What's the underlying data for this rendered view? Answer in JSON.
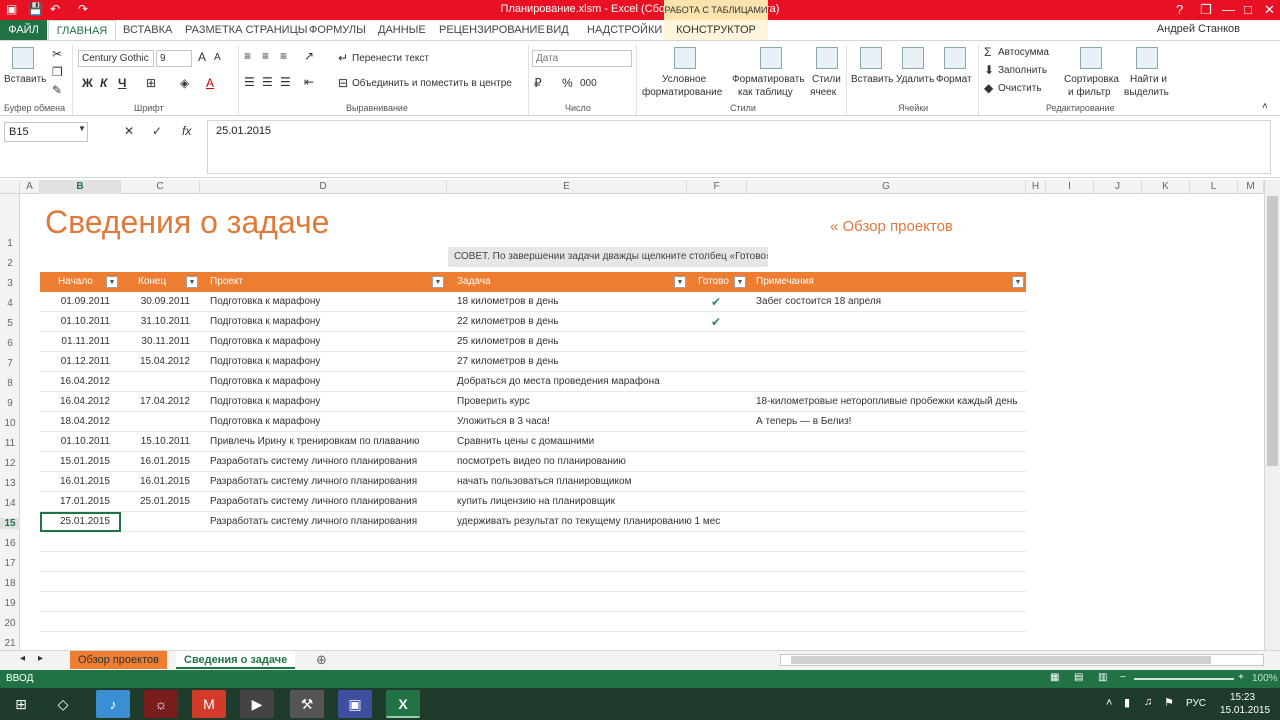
{
  "titlebar": {
    "title": "Планирование.xlsm - Excel (Сбой активации продукта)",
    "context_tab": "РАБОТА С ТАБЛИЦАМИ",
    "help": "?",
    "restore": "❐",
    "minimize": "—",
    "maximize": "□",
    "close": "✕"
  },
  "ribbon_tabs": {
    "file": "ФАЙЛ",
    "home": "ГЛАВНАЯ",
    "insert": "ВСТАВКА",
    "layout": "РАЗМЕТКА СТРАНИЦЫ",
    "formulas": "ФОРМУЛЫ",
    "data": "ДАННЫЕ",
    "review": "РЕЦЕНЗИРОВАНИЕ",
    "view": "ВИД",
    "addins": "НАДСТРОЙКИ",
    "constructor": "КОНСТРУКТОР",
    "user": "Андрей Станков"
  },
  "ribbon": {
    "paste": "Вставить",
    "clipboard": "Буфер обмена",
    "font_name": "Century Gothic",
    "font_size": "9",
    "font_group": "Шрифт",
    "bold": "Ж",
    "italic": "К",
    "underline": "Ч",
    "wrap_text": "Перенести текст",
    "merge_center": "Объединить и поместить в центре",
    "alignment_group": "Выравнивание",
    "number_format": "Дата",
    "number_group": "Число",
    "percent": "%",
    "thousands": "000",
    "conditional_1": "Условное",
    "conditional_2": "форматирование",
    "format_table_1": "Форматировать",
    "format_table_2": "как таблицу",
    "cell_styles_1": "Стили",
    "cell_styles_2": "ячеек",
    "styles_group": "Стили",
    "insert_cells": "Вставить",
    "delete_cells": "Удалить",
    "format_cells": "Формат",
    "cells_group": "Ячейки",
    "autosum": "Автосумма",
    "fill": "Заполнить",
    "clear": "Очистить",
    "sort_1": "Сортировка",
    "sort_2": "и фильтр",
    "find_1": "Найти и",
    "find_2": "выделить",
    "editing_group": "Редактирование"
  },
  "formula_bar": {
    "name_box": "B15",
    "cancel": "✕",
    "enter": "✓",
    "fx": "fx",
    "value": "25.01.2015"
  },
  "columns": [
    "A",
    "B",
    "C",
    "D",
    "E",
    "F",
    "G",
    "H",
    "I",
    "J",
    "K",
    "L",
    "M"
  ],
  "rows": [
    "1",
    "2",
    "3",
    "4",
    "5",
    "6",
    "7",
    "8",
    "9",
    "10",
    "11",
    "12",
    "13",
    "14",
    "15",
    "16",
    "17",
    "18",
    "19",
    "20",
    "21"
  ],
  "sheet": {
    "title": "Сведения о задаче",
    "nav_link": "« Обзор проектов",
    "tip": "СОВЕТ. По завершении задачи дважды щелкните столбец «Готово»",
    "headers": [
      "Начало",
      "Конец",
      "Проект",
      "Задача",
      "Готово",
      "Примечания"
    ],
    "filter_glyph": "▼",
    "check_glyph": "✔",
    "table": [
      {
        "start": "01.09.2011",
        "end": "30.09.2011",
        "project": "Подготовка к марафону",
        "task": "18 километров в день",
        "done": true,
        "notes": "Забег состоится 18 апреля"
      },
      {
        "start": "01.10.2011",
        "end": "31.10.2011",
        "project": "Подготовка к марафону",
        "task": "22 километров в день",
        "done": true,
        "notes": ""
      },
      {
        "start": "01.11.2011",
        "end": "30.11.2011",
        "project": "Подготовка к марафону",
        "task": "25 километров в день",
        "done": false,
        "notes": ""
      },
      {
        "start": "01.12.2011",
        "end": "15.04.2012",
        "project": "Подготовка к марафону",
        "task": "27 километров в день",
        "done": false,
        "notes": ""
      },
      {
        "start": "16.04.2012",
        "end": "",
        "project": "Подготовка к марафону",
        "task": "Добраться до места проведения марафона",
        "done": false,
        "notes": ""
      },
      {
        "start": "16.04.2012",
        "end": "17.04.2012",
        "project": "Подготовка к марафону",
        "task": "Проверить курс",
        "done": false,
        "notes": "18-километровые неторопливые пробежки каждый день"
      },
      {
        "start": "18.04.2012",
        "end": "",
        "project": "Подготовка к марафону",
        "task": "Уложиться в 3 часа!",
        "done": false,
        "notes": "А теперь — в Белиз!"
      },
      {
        "start": "01.10.2011",
        "end": "15.10.2011",
        "project": "Привлечь Ирину к тренировкам по плаванию",
        "task": "Сравнить цены с домашними",
        "done": false,
        "notes": ""
      },
      {
        "start": "15.01.2015",
        "end": "16.01.2015",
        "project": "Разработать систему личного планирования",
        "task": "посмотреть видео по планированию",
        "done": false,
        "notes": ""
      },
      {
        "start": "16.01.2015",
        "end": "16.01.2015",
        "project": "Разработать систему личного планирования",
        "task": "начать пользоваться планировщиком",
        "done": false,
        "notes": ""
      },
      {
        "start": "17.01.2015",
        "end": "25.01.2015",
        "project": "Разработать систему личного планирования",
        "task": "купить лицензию на планировщик",
        "done": false,
        "notes": ""
      },
      {
        "start": "25.01.2015",
        "end": "",
        "project": "Разработать систему личного планирования",
        "task": "удерживать результат по текущему планированию 1 мес",
        "done": false,
        "notes": ""
      }
    ]
  },
  "sheet_tabs": {
    "tab1": "Обзор проектов",
    "tab2": "Сведения о задаче",
    "add": "⊕",
    "prev": "◂",
    "next": "▸"
  },
  "status": {
    "mode": "ВВОД",
    "zoom": "100%"
  },
  "taskbar": {
    "lang": "РУС",
    "time": "15:23",
    "date": "15.01.2015",
    "excel": "X"
  },
  "colors": {
    "accent": "#217346",
    "title_red": "#e81123",
    "orange": "#ed7d31",
    "title_orange": "#e07a3b"
  }
}
